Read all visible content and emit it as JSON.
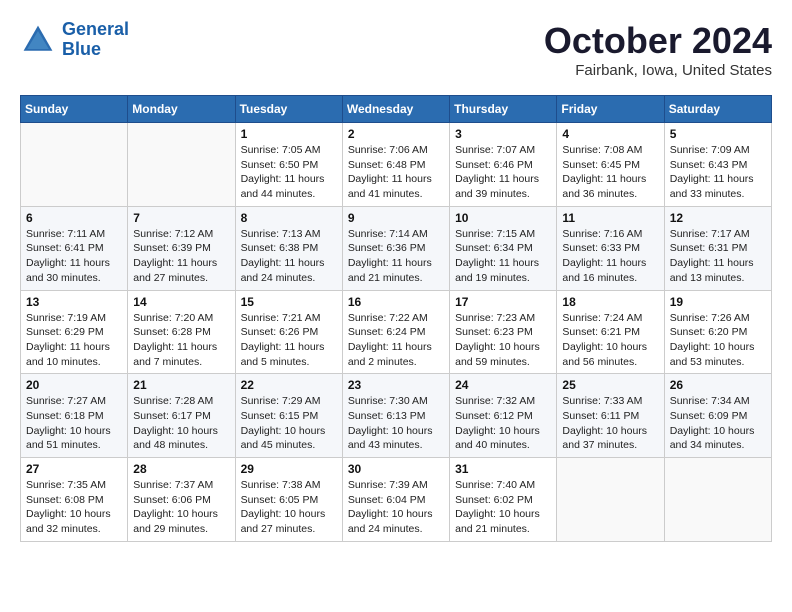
{
  "header": {
    "logo_line1": "General",
    "logo_line2": "Blue",
    "title": "October 2024",
    "subtitle": "Fairbank, Iowa, United States"
  },
  "days_of_week": [
    "Sunday",
    "Monday",
    "Tuesday",
    "Wednesday",
    "Thursday",
    "Friday",
    "Saturday"
  ],
  "weeks": [
    [
      {
        "day": "",
        "info": ""
      },
      {
        "day": "",
        "info": ""
      },
      {
        "day": "1",
        "info": "Sunrise: 7:05 AM\nSunset: 6:50 PM\nDaylight: 11 hours and 44 minutes."
      },
      {
        "day": "2",
        "info": "Sunrise: 7:06 AM\nSunset: 6:48 PM\nDaylight: 11 hours and 41 minutes."
      },
      {
        "day": "3",
        "info": "Sunrise: 7:07 AM\nSunset: 6:46 PM\nDaylight: 11 hours and 39 minutes."
      },
      {
        "day": "4",
        "info": "Sunrise: 7:08 AM\nSunset: 6:45 PM\nDaylight: 11 hours and 36 minutes."
      },
      {
        "day": "5",
        "info": "Sunrise: 7:09 AM\nSunset: 6:43 PM\nDaylight: 11 hours and 33 minutes."
      }
    ],
    [
      {
        "day": "6",
        "info": "Sunrise: 7:11 AM\nSunset: 6:41 PM\nDaylight: 11 hours and 30 minutes."
      },
      {
        "day": "7",
        "info": "Sunrise: 7:12 AM\nSunset: 6:39 PM\nDaylight: 11 hours and 27 minutes."
      },
      {
        "day": "8",
        "info": "Sunrise: 7:13 AM\nSunset: 6:38 PM\nDaylight: 11 hours and 24 minutes."
      },
      {
        "day": "9",
        "info": "Sunrise: 7:14 AM\nSunset: 6:36 PM\nDaylight: 11 hours and 21 minutes."
      },
      {
        "day": "10",
        "info": "Sunrise: 7:15 AM\nSunset: 6:34 PM\nDaylight: 11 hours and 19 minutes."
      },
      {
        "day": "11",
        "info": "Sunrise: 7:16 AM\nSunset: 6:33 PM\nDaylight: 11 hours and 16 minutes."
      },
      {
        "day": "12",
        "info": "Sunrise: 7:17 AM\nSunset: 6:31 PM\nDaylight: 11 hours and 13 minutes."
      }
    ],
    [
      {
        "day": "13",
        "info": "Sunrise: 7:19 AM\nSunset: 6:29 PM\nDaylight: 11 hours and 10 minutes."
      },
      {
        "day": "14",
        "info": "Sunrise: 7:20 AM\nSunset: 6:28 PM\nDaylight: 11 hours and 7 minutes."
      },
      {
        "day": "15",
        "info": "Sunrise: 7:21 AM\nSunset: 6:26 PM\nDaylight: 11 hours and 5 minutes."
      },
      {
        "day": "16",
        "info": "Sunrise: 7:22 AM\nSunset: 6:24 PM\nDaylight: 11 hours and 2 minutes."
      },
      {
        "day": "17",
        "info": "Sunrise: 7:23 AM\nSunset: 6:23 PM\nDaylight: 10 hours and 59 minutes."
      },
      {
        "day": "18",
        "info": "Sunrise: 7:24 AM\nSunset: 6:21 PM\nDaylight: 10 hours and 56 minutes."
      },
      {
        "day": "19",
        "info": "Sunrise: 7:26 AM\nSunset: 6:20 PM\nDaylight: 10 hours and 53 minutes."
      }
    ],
    [
      {
        "day": "20",
        "info": "Sunrise: 7:27 AM\nSunset: 6:18 PM\nDaylight: 10 hours and 51 minutes."
      },
      {
        "day": "21",
        "info": "Sunrise: 7:28 AM\nSunset: 6:17 PM\nDaylight: 10 hours and 48 minutes."
      },
      {
        "day": "22",
        "info": "Sunrise: 7:29 AM\nSunset: 6:15 PM\nDaylight: 10 hours and 45 minutes."
      },
      {
        "day": "23",
        "info": "Sunrise: 7:30 AM\nSunset: 6:13 PM\nDaylight: 10 hours and 43 minutes."
      },
      {
        "day": "24",
        "info": "Sunrise: 7:32 AM\nSunset: 6:12 PM\nDaylight: 10 hours and 40 minutes."
      },
      {
        "day": "25",
        "info": "Sunrise: 7:33 AM\nSunset: 6:11 PM\nDaylight: 10 hours and 37 minutes."
      },
      {
        "day": "26",
        "info": "Sunrise: 7:34 AM\nSunset: 6:09 PM\nDaylight: 10 hours and 34 minutes."
      }
    ],
    [
      {
        "day": "27",
        "info": "Sunrise: 7:35 AM\nSunset: 6:08 PM\nDaylight: 10 hours and 32 minutes."
      },
      {
        "day": "28",
        "info": "Sunrise: 7:37 AM\nSunset: 6:06 PM\nDaylight: 10 hours and 29 minutes."
      },
      {
        "day": "29",
        "info": "Sunrise: 7:38 AM\nSunset: 6:05 PM\nDaylight: 10 hours and 27 minutes."
      },
      {
        "day": "30",
        "info": "Sunrise: 7:39 AM\nSunset: 6:04 PM\nDaylight: 10 hours and 24 minutes."
      },
      {
        "day": "31",
        "info": "Sunrise: 7:40 AM\nSunset: 6:02 PM\nDaylight: 10 hours and 21 minutes."
      },
      {
        "day": "",
        "info": ""
      },
      {
        "day": "",
        "info": ""
      }
    ]
  ]
}
